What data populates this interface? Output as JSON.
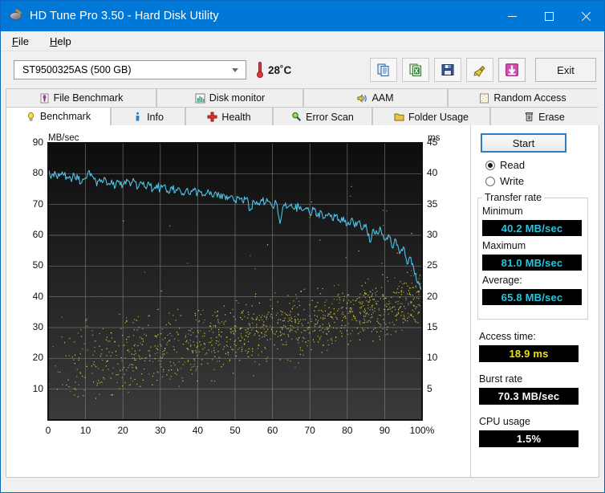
{
  "window": {
    "title": "HD Tune Pro 3.50 - Hard Disk Utility",
    "icon": "hdd-icon",
    "minimize_label": "Minimize",
    "maximize_label": "Maximize",
    "close_label": "Close",
    "accent": "#0078d7"
  },
  "menu": {
    "items": [
      {
        "label": "File",
        "mnemonic": "F"
      },
      {
        "label": "Help",
        "mnemonic": "H"
      }
    ]
  },
  "toolbar": {
    "drive_selected": "ST9500325AS (500 GB)",
    "temperature": "28˚C",
    "buttons": [
      {
        "name": "copy-to-clipboard-button",
        "icon": "copy-icon"
      },
      {
        "name": "export-excel-button",
        "icon": "excel-export-icon"
      },
      {
        "name": "save-button",
        "icon": "floppy-save-icon"
      },
      {
        "name": "settings-button",
        "icon": "brush-icon"
      },
      {
        "name": "download-button",
        "icon": "download-arrow-icon"
      }
    ],
    "exit_label": "Exit"
  },
  "tabs": {
    "row1": [
      {
        "label": "File Benchmark",
        "icon": "file-benchmark-icon",
        "active": false
      },
      {
        "label": "Disk monitor",
        "icon": "disk-monitor-icon",
        "active": false
      },
      {
        "label": "AAM",
        "icon": "aam-speaker-icon",
        "active": false
      },
      {
        "label": "Random Access",
        "icon": "random-access-icon",
        "active": false
      }
    ],
    "row2": [
      {
        "label": "Benchmark",
        "icon": "benchmark-bulb-icon",
        "active": true
      },
      {
        "label": "Info",
        "icon": "info-icon",
        "active": false
      },
      {
        "label": "Health",
        "icon": "health-cross-icon",
        "active": false
      },
      {
        "label": "Error Scan",
        "icon": "magnifier-icon",
        "active": false
      },
      {
        "label": "Folder Usage",
        "icon": "folder-icon",
        "active": false
      },
      {
        "label": "Erase",
        "icon": "trash-icon",
        "active": false
      }
    ]
  },
  "panel": {
    "start_label": "Start",
    "mode_read_label": "Read",
    "mode_write_label": "Write",
    "mode_selected": "Read",
    "transfer_rate_group": "Transfer rate",
    "minimum_label": "Minimum",
    "minimum_value": "40.2 MB/sec",
    "maximum_label": "Maximum",
    "maximum_value": "81.0 MB/sec",
    "average_label": "Average:",
    "average_value": "65.8 MB/sec",
    "access_time_label": "Access time:",
    "access_time_value": "18.9 ms",
    "burst_rate_label": "Burst rate",
    "burst_rate_value": "70.3 MB/sec",
    "cpu_usage_label": "CPU usage",
    "cpu_usage_value": "1.5%"
  },
  "chart_data": {
    "type": "line",
    "title": "",
    "xlabel": "100%",
    "x_axis_suffix": "%",
    "ylabel": "MB/sec",
    "y2label": "ms",
    "grid": true,
    "plot_bg": "#1b1b1b",
    "series_colors": {
      "transfer_rate": "#4fc3e8",
      "access_time": "#e6e24a"
    },
    "xlim": [
      0,
      100
    ],
    "x_ticks": [
      0,
      10,
      20,
      30,
      40,
      50,
      60,
      70,
      80,
      90,
      100
    ],
    "x_tick_labels": [
      "0",
      "10",
      "20",
      "30",
      "40",
      "50",
      "60",
      "70",
      "80",
      "90",
      "100%"
    ],
    "ylim": [
      0,
      90
    ],
    "y_ticks": [
      10,
      20,
      30,
      40,
      50,
      60,
      70,
      80,
      90
    ],
    "y2lim": [
      0,
      45
    ],
    "y2_ticks": [
      5,
      10,
      15,
      20,
      25,
      30,
      35,
      40,
      45
    ],
    "series": [
      {
        "name": "Transfer rate",
        "axis": "left",
        "unit": "MB/sec",
        "color": "#4fc3e8",
        "x": [
          0,
          1,
          2,
          3,
          4,
          5,
          6,
          7,
          8,
          9,
          10,
          11,
          12,
          13,
          14,
          15,
          16,
          17,
          18,
          19,
          20,
          21,
          22,
          23,
          24,
          25,
          26,
          27,
          28,
          29,
          30,
          31,
          32,
          33,
          34,
          35,
          36,
          37,
          38,
          39,
          40,
          41,
          42,
          43,
          44,
          45,
          46,
          47,
          48,
          49,
          50,
          51,
          52,
          53,
          54,
          55,
          56,
          57,
          58,
          59,
          60,
          61,
          62,
          63,
          64,
          65,
          66,
          67,
          68,
          69,
          70,
          71,
          72,
          73,
          74,
          75,
          76,
          77,
          78,
          79,
          80,
          81,
          82,
          83,
          84,
          85,
          86,
          87,
          88,
          89,
          90,
          91,
          92,
          93,
          94,
          95,
          96,
          97,
          98,
          99,
          100
        ],
        "y": [
          80.2,
          79.6,
          80.0,
          79.2,
          79.8,
          79.0,
          78.4,
          79.6,
          78.2,
          77.2,
          78.6,
          81.0,
          79.0,
          76.0,
          77.4,
          78.8,
          76.6,
          78.0,
          75.8,
          77.6,
          76.4,
          78.2,
          76.0,
          77.8,
          75.4,
          77.0,
          75.6,
          76.8,
          74.8,
          76.4,
          75.0,
          76.2,
          74.4,
          75.8,
          74.0,
          75.4,
          73.6,
          75.0,
          73.2,
          74.6,
          73.8,
          74.2,
          72.8,
          74.0,
          72.4,
          73.6,
          72.0,
          73.2,
          71.6,
          72.8,
          71.2,
          72.4,
          70.8,
          72.0,
          68.0,
          71.2,
          70.0,
          71.6,
          70.4,
          71.0,
          69.2,
          70.6,
          63.8,
          69.8,
          69.0,
          70.2,
          68.6,
          69.4,
          68.0,
          69.0,
          66.8,
          68.4,
          66.2,
          67.8,
          65.6,
          67.2,
          65.0,
          66.6,
          64.4,
          66.0,
          63.4,
          65.2,
          62.6,
          64.4,
          61.8,
          63.6,
          57.8,
          62.0,
          60.6,
          61.8,
          58.4,
          60.2,
          56.0,
          58.6,
          54.0,
          56.2,
          50.6,
          52.8,
          47.4,
          45.0,
          42.0
        ]
      },
      {
        "name": "Access time",
        "axis": "right",
        "unit": "ms",
        "color": "#e6e24a",
        "type": "scatter",
        "average_ms": 18.9,
        "point_count": 1200,
        "ms_range_low": 4,
        "ms_range_high": 45,
        "note": "Dense yellow scatter cloud, denser at left, rising band from ~8 ms to ~22 ms across 0-100%"
      }
    ]
  }
}
